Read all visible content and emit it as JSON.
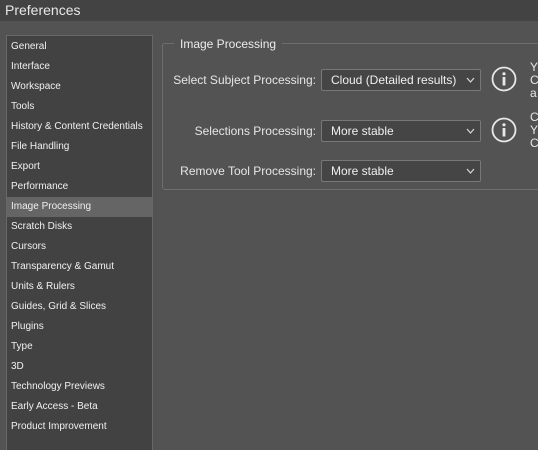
{
  "window": {
    "title": "Preferences"
  },
  "sidebar": {
    "items": [
      {
        "label": "General"
      },
      {
        "label": "Interface"
      },
      {
        "label": "Workspace"
      },
      {
        "label": "Tools"
      },
      {
        "label": "History & Content Credentials"
      },
      {
        "label": "File Handling"
      },
      {
        "label": "Export"
      },
      {
        "label": "Performance"
      },
      {
        "label": "Image Processing",
        "selected": true
      },
      {
        "label": "Scratch Disks"
      },
      {
        "label": "Cursors"
      },
      {
        "label": "Transparency & Gamut"
      },
      {
        "label": "Units & Rulers"
      },
      {
        "label": "Guides, Grid & Slices"
      },
      {
        "label": "Plugins"
      },
      {
        "label": "Type"
      },
      {
        "label": "3D"
      },
      {
        "label": "Technology Previews"
      },
      {
        "label": "Early Access - Beta"
      },
      {
        "label": "Product Improvement"
      }
    ]
  },
  "image_processing": {
    "group_title": "Image Processing",
    "select_subject": {
      "label": "Select Subject Processing:",
      "value": "Cloud (Detailed results)",
      "hint_lines": [
        "Y",
        "C",
        "a"
      ]
    },
    "selections": {
      "label": "Selections Processing:",
      "value": "More stable",
      "hint_lines": [
        "C",
        "Y",
        "C"
      ]
    },
    "remove_tool": {
      "label": "Remove Tool Processing:",
      "value": "More stable"
    }
  },
  "colors": {
    "background": "#535353",
    "titlebar": "#434343",
    "sidebar_bg": "#424242",
    "sidebar_selected": "#656565",
    "dropdown_bg": "#454545"
  }
}
